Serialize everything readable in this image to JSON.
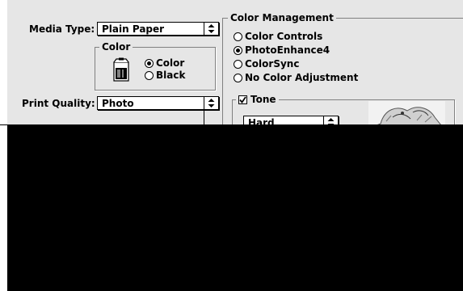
{
  "media_type": {
    "label": "Media Type:",
    "value": "Plain Paper"
  },
  "color_group": {
    "title": "Color",
    "options": [
      {
        "label": "Color",
        "selected": true
      },
      {
        "label": "Black",
        "selected": false
      }
    ],
    "icon": "ink-cartridge-icon"
  },
  "print_quality": {
    "label": "Print Quality:",
    "value": "Photo"
  },
  "color_management": {
    "title": "Color Management",
    "options": [
      {
        "label": "Color Controls",
        "selected": false
      },
      {
        "label": "PhotoEnhance4",
        "selected": true
      },
      {
        "label": "ColorSync",
        "selected": false
      },
      {
        "label": "No Color Adjustment",
        "selected": false
      }
    ]
  },
  "tone": {
    "label": "Tone",
    "checked": true,
    "value": "Hard",
    "preview_icon": "sample-photo-thumbnail"
  },
  "colors": {
    "dialog_bg": "#e6e6e6",
    "redaction": "#000000"
  }
}
